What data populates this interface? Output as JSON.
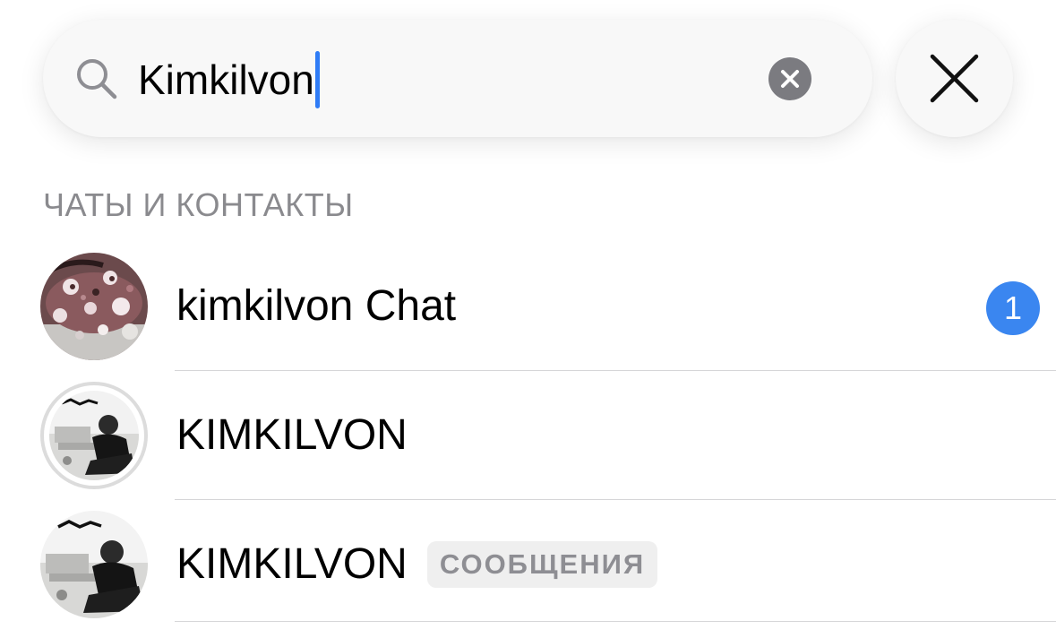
{
  "search": {
    "value": "Kimkilvon",
    "icon": "search-icon",
    "clear_icon": "clear-icon",
    "close_icon": "close-icon"
  },
  "section": {
    "title": "ЧАТЫ И КОНТАКТЫ"
  },
  "results": [
    {
      "name": "kimkilvon Chat",
      "unread_count": "1",
      "avatar": "chat-avatar-image"
    },
    {
      "name": "KIMKILVON",
      "avatar": "profile-avatar-image"
    },
    {
      "name": "KIMKILVON",
      "tag": "СООБЩЕНИЯ",
      "avatar": "profile-avatar-image"
    }
  ],
  "colors": {
    "accent": "#3a86f0",
    "caret": "#2f7cf6",
    "secondary_text": "#8a8a8e"
  }
}
